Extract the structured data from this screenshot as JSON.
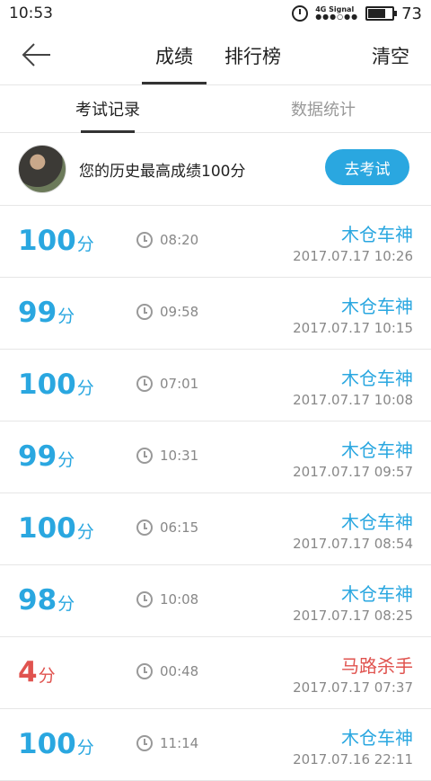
{
  "status_bar": {
    "time": "10:53",
    "signal_top": "4G Signal",
    "signal_dots": "●●●○●●",
    "battery_level": 0.73,
    "battery_text": "73"
  },
  "nav": {
    "back_icon": "arrow-left-icon",
    "tabs": [
      {
        "label": "成绩",
        "active": true
      },
      {
        "label": "排行榜",
        "active": false
      }
    ],
    "clear_label": "清空"
  },
  "sub_tabs": [
    {
      "label": "考试记录",
      "active": true
    },
    {
      "label": "数据统计",
      "active": false
    }
  ],
  "profile": {
    "best_text": "您的历史最高成绩100分",
    "button_label": "去考试"
  },
  "colors": {
    "accent": "#2aa7e0",
    "warning": "#e0534f"
  },
  "records": [
    {
      "score": "100",
      "unit": "分",
      "duration": "08:20",
      "title": "木仓车神",
      "time": "2017.07.17  10:26",
      "status": "good"
    },
    {
      "score": "99",
      "unit": "分",
      "duration": "09:58",
      "title": "木仓车神",
      "time": "2017.07.17  10:15",
      "status": "good"
    },
    {
      "score": "100",
      "unit": "分",
      "duration": "07:01",
      "title": "木仓车神",
      "time": "2017.07.17  10:08",
      "status": "good"
    },
    {
      "score": "99",
      "unit": "分",
      "duration": "10:31",
      "title": "木仓车神",
      "time": "2017.07.17  09:57",
      "status": "good"
    },
    {
      "score": "100",
      "unit": "分",
      "duration": "06:15",
      "title": "木仓车神",
      "time": "2017.07.17  08:54",
      "status": "good"
    },
    {
      "score": "98",
      "unit": "分",
      "duration": "10:08",
      "title": "木仓车神",
      "time": "2017.07.17  08:25",
      "status": "good"
    },
    {
      "score": "4",
      "unit": "分",
      "duration": "00:48",
      "title": "马路杀手",
      "time": "2017.07.17  07:37",
      "status": "bad"
    },
    {
      "score": "100",
      "unit": "分",
      "duration": "11:14",
      "title": "木仓车神",
      "time": "2017.07.16  22:11",
      "status": "good"
    }
  ]
}
